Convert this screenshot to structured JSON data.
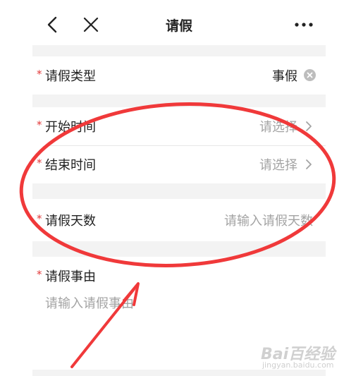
{
  "nav": {
    "title": "请假"
  },
  "form": {
    "leave_type": {
      "required_mark": "*",
      "label": "请假类型",
      "value": "事假"
    },
    "start_time": {
      "required_mark": "*",
      "label": "开始时间",
      "placeholder": "请选择"
    },
    "end_time": {
      "required_mark": "*",
      "label": "结束时间",
      "placeholder": "请选择"
    },
    "days": {
      "required_mark": "*",
      "label": "请假天数",
      "placeholder": "请输入请假天数"
    },
    "reason": {
      "required_mark": "*",
      "label": "请假事由",
      "placeholder": "请输入请假事由"
    }
  },
  "annotation": {
    "color": "#f0393a"
  },
  "watermark": {
    "text": "Bai百经验",
    "sub": "jingyan.baidu.com"
  }
}
